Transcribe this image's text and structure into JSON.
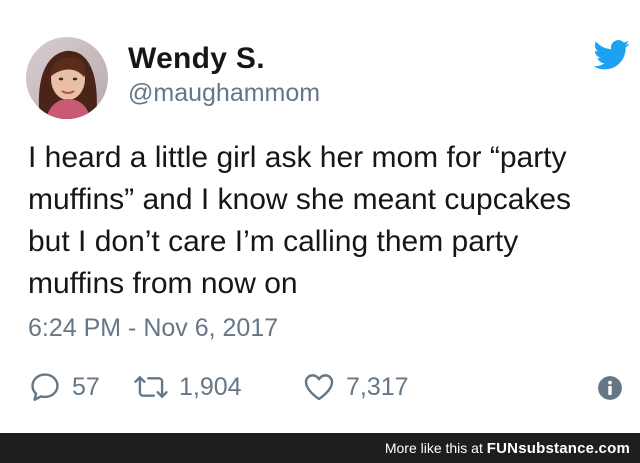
{
  "user": {
    "name": "Wendy S.",
    "handle": "@maughammom"
  },
  "tweet": {
    "lines": [
      "I heard a little girl ask her mom for “party",
      "muffins” and I know she meant cupcakes",
      "but I don’t care I’m calling them party",
      "muffins from now on"
    ],
    "timestamp": "6:24 PM - Nov 6, 2017"
  },
  "actions": {
    "replies": "57",
    "retweets": "1,904",
    "likes": "7,317"
  },
  "icons": {
    "brand": "twitter-bird-icon",
    "reply": "reply-icon",
    "retweet": "retweet-icon",
    "like": "heart-icon",
    "info": "info-icon"
  },
  "footer": {
    "prefix": "More like this at",
    "brand": "FUNsubstance.com"
  },
  "colors": {
    "twitter_blue": "#1da1f2",
    "text": "#14171a",
    "muted": "#657786",
    "footer_bg": "#1e1e1e"
  }
}
